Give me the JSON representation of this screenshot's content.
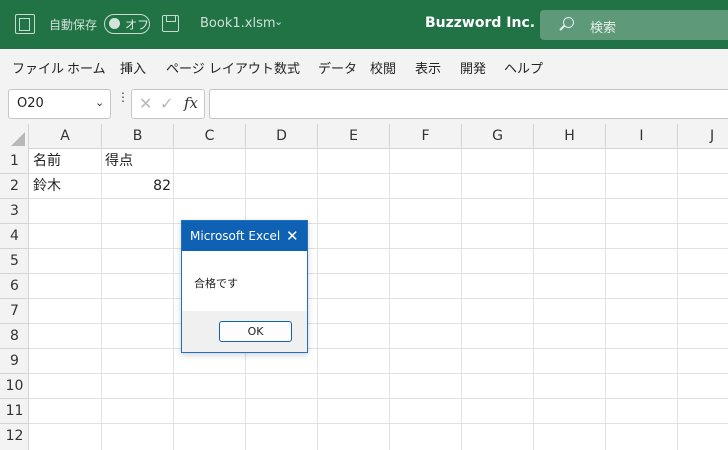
{
  "titlebar": {
    "autosave_label": "自動保存",
    "autosave_state": "オフ",
    "filename": "Book1.xlsm",
    "company": "Buzzword Inc.",
    "search_placeholder": "検索",
    "bg_color": "#217346"
  },
  "menu": {
    "items": [
      "ファイル",
      "ホーム",
      "挿入",
      "ページ レイアウト",
      "数式",
      "データ",
      "校閲",
      "表示",
      "開発",
      "ヘルプ"
    ]
  },
  "formula_bar": {
    "name_box": "O20",
    "fx_label": "fx",
    "content": ""
  },
  "sheet": {
    "columns": [
      "A",
      "B",
      "C",
      "D",
      "E",
      "F",
      "G",
      "H",
      "I",
      "J"
    ],
    "rows": [
      "1",
      "2",
      "3",
      "4",
      "5",
      "6",
      "7",
      "8",
      "9",
      "10",
      "11",
      "12"
    ],
    "cells": {
      "A1": "名前",
      "B1": "得点",
      "A2": "鈴木",
      "B2": "82"
    }
  },
  "dialog": {
    "title": "Microsoft Excel",
    "message": "合格です",
    "ok_label": "OK",
    "title_color": "#0f61b3"
  }
}
